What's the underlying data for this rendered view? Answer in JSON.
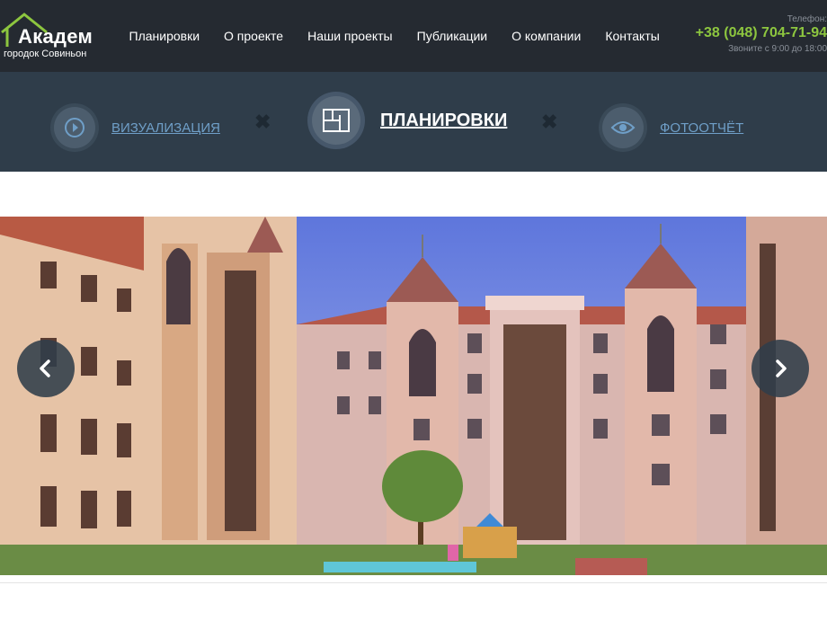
{
  "header": {
    "logo": {
      "title": "Академ",
      "subtitle": "городок Совиньон"
    },
    "nav": [
      "Планировки",
      "О проекте",
      "Наши проекты",
      "Публикации",
      "О компании",
      "Контакты"
    ],
    "phone": {
      "label": "Телефон:",
      "number": "+38 (048) 704-71-94",
      "hours": "Звоните с 9:00 до 18:00"
    }
  },
  "tabs": {
    "items": [
      {
        "label": "ВИЗУАЛИЗАЦИЯ",
        "icon": "play-icon",
        "active": false
      },
      {
        "label": "ПЛАНИРОВКИ",
        "icon": "floorplan-icon",
        "active": true
      },
      {
        "label": "ФОТООТЧЁТ",
        "icon": "eye-icon",
        "active": false
      }
    ],
    "separator": "✖"
  },
  "slider": {
    "prev_icon": "chevron-left-icon",
    "next_icon": "chevron-right-icon"
  },
  "colors": {
    "header_bg": "#252a31",
    "tabs_bg": "#2f3d4a",
    "accent_green": "#8dc63f",
    "link_blue": "#6f9fc8"
  }
}
